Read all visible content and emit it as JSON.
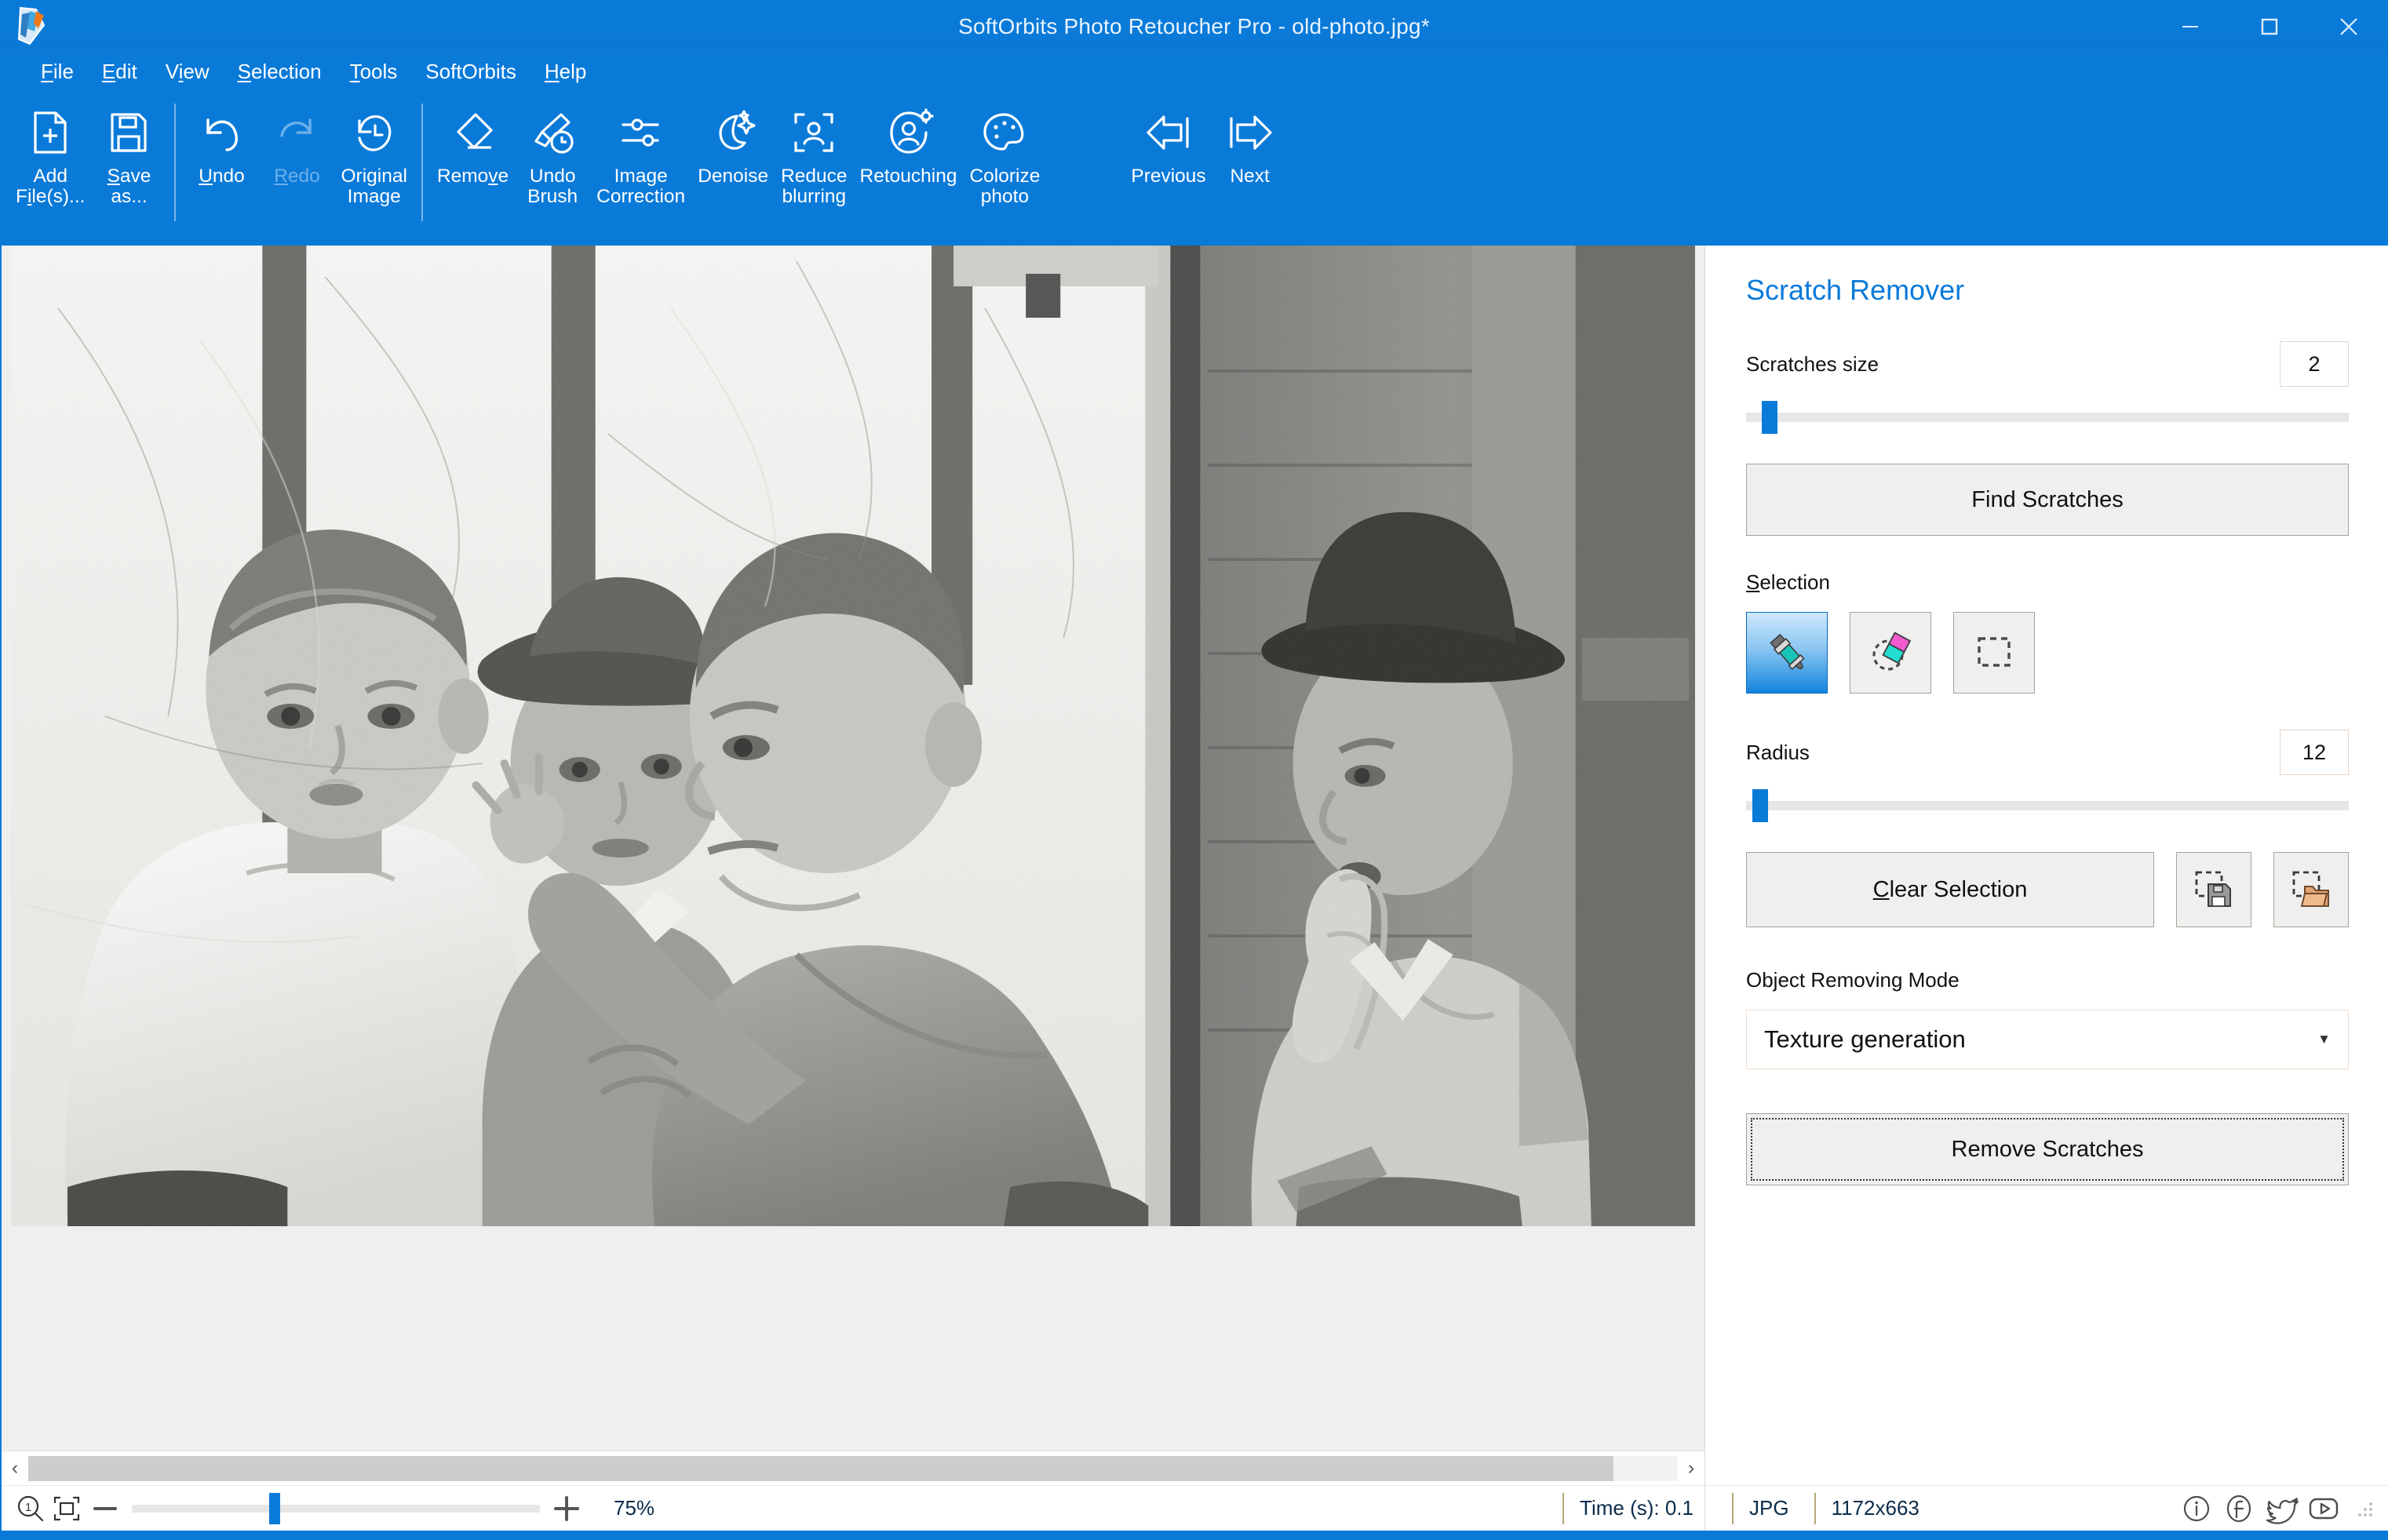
{
  "window": {
    "title": "SoftOrbits Photo Retoucher Pro - old-photo.jpg*",
    "logo_icon": "softorbits-logo-icon",
    "controls": {
      "minimize": "minimize-icon",
      "maximize": "maximize-icon",
      "close": "close-icon"
    }
  },
  "menubar": {
    "items": [
      {
        "label": "File",
        "accel": "F"
      },
      {
        "label": "Edit",
        "accel": "E"
      },
      {
        "label": "View",
        "accel": "V"
      },
      {
        "label": "Selection",
        "accel": "S"
      },
      {
        "label": "Tools",
        "accel": "T"
      },
      {
        "label": "SoftOrbits",
        "accel": ""
      },
      {
        "label": "Help",
        "accel": "H"
      }
    ]
  },
  "toolbar": {
    "items": [
      {
        "label_line1": "Add",
        "label_line2": "File(s)...",
        "icon": "add-file-icon",
        "accel": "i",
        "disabled": false
      },
      {
        "label_line1": "Save",
        "label_line2": "as...",
        "icon": "save-as-icon",
        "accel": "S",
        "disabled": false
      },
      {
        "label_line1": "Undo",
        "label_line2": "",
        "icon": "undo-arrow-icon",
        "accel": "U",
        "disabled": false
      },
      {
        "label_line1": "Redo",
        "label_line2": "",
        "icon": "redo-arrow-icon",
        "accel": "R",
        "disabled": true
      },
      {
        "label_line1": "Original",
        "label_line2": "Image",
        "icon": "history-clock-icon",
        "disabled": false
      },
      {
        "label_line1": "Remove",
        "label_line2": "",
        "icon": "eraser-icon",
        "accel": "v",
        "disabled": false
      },
      {
        "label_line1": "Undo",
        "label_line2": "Brush",
        "icon": "undo-brush-icon",
        "disabled": false
      },
      {
        "label_line1": "Image",
        "label_line2": "Correction",
        "icon": "sliders-icon",
        "disabled": false
      },
      {
        "label_line1": "Denoise",
        "label_line2": "",
        "icon": "moon-stars-icon",
        "disabled": false
      },
      {
        "label_line1": "Reduce",
        "label_line2": "blurring",
        "icon": "portrait-frame-icon",
        "disabled": false
      },
      {
        "label_line1": "Retouching",
        "label_line2": "",
        "icon": "portrait-gear-icon",
        "disabled": false
      },
      {
        "label_line1": "Colorize",
        "label_line2": "photo",
        "icon": "palette-icon",
        "disabled": false
      },
      {
        "label_line1": "Previous",
        "label_line2": "",
        "icon": "arrow-left-icon",
        "disabled": false
      },
      {
        "label_line1": "Next",
        "label_line2": "",
        "icon": "arrow-right-icon",
        "disabled": false
      }
    ]
  },
  "panel": {
    "title": "Scratch Remover",
    "scratches_size": {
      "label": "Scratches size",
      "value": "2",
      "slider_percent": 6
    },
    "find_scratches_label": "Find Scratches",
    "selection": {
      "label": "Selection",
      "accel": "S",
      "tools": [
        {
          "name": "marker-pen-tool",
          "icon": "marker-pen-icon",
          "active": true
        },
        {
          "name": "eraser-tool",
          "icon": "selection-eraser-icon",
          "active": false
        },
        {
          "name": "rectangle-select-tool",
          "icon": "dashed-rectangle-icon",
          "active": false
        }
      ]
    },
    "radius": {
      "label": "Radius",
      "value": "12",
      "slider_percent": 3
    },
    "clear_selection_label": "Clear Selection",
    "clear_selection_accel": "C",
    "save_selection_icon": "save-selection-icon",
    "load_selection_icon": "load-selection-icon",
    "object_removing_mode": {
      "label": "Object Removing Mode",
      "value": "Texture generation",
      "options": [
        "Texture generation"
      ]
    },
    "remove_scratches_label": "Remove Scratches"
  },
  "statusbar": {
    "zoom_actual_icon": "zoom-actual-size-icon",
    "zoom_fit_icon": "zoom-fit-window-icon",
    "zoom_out_icon": "minus-icon",
    "zoom_in_icon": "plus-icon",
    "zoom_percent": "75%",
    "zoom_slider_percent": 34,
    "time_label": "Time (s): 0.1",
    "format": "JPG",
    "dimensions": "1172x663",
    "social": [
      {
        "name": "info-icon",
        "glyph": "i"
      },
      {
        "name": "facebook-icon",
        "glyph": "f"
      },
      {
        "name": "twitter-icon",
        "glyph": "t"
      },
      {
        "name": "youtube-icon",
        "glyph": "y"
      }
    ]
  },
  "scrollbar": {
    "left_arrow_icon": "chevron-left-icon",
    "right_arrow_icon": "chevron-right-icon"
  },
  "colors": {
    "brand_blue": "#0a7ad9",
    "panel_title": "#0a7ad9",
    "slider_thumb": "#0a7ad9",
    "button_face": "#efefef"
  },
  "photo": {
    "alt": "Vintage black and white photo: barber cutting a boy's hair on a porch, two onlookers in hats"
  }
}
